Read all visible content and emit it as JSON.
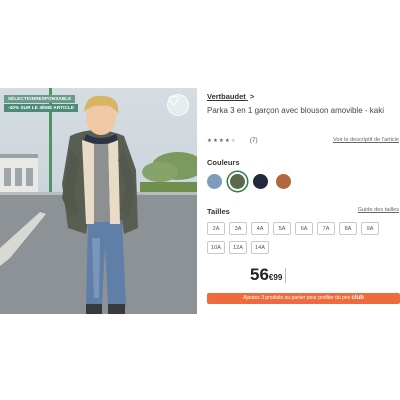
{
  "image": {
    "badge_eco": "SÉLECTIONRESPONSABLE",
    "badge_promo": "-40% SUR LE 3ÈME ARTICLE"
  },
  "product": {
    "brand": "Vertbaudet",
    "brand_arrow": ">",
    "title": "Parka 3 en 1 garçon avec blouson amovible - kaki",
    "rating_value": 4,
    "rating_count": "(7)",
    "description_link": "Voir le descriptif de l'article"
  },
  "colors": {
    "label": "Couleurs",
    "swatches": [
      {
        "name": "blue",
        "hex": "#7f9cbd",
        "selected": false
      },
      {
        "name": "khaki",
        "hex": "#5b6a4c",
        "selected": true
      },
      {
        "name": "navy",
        "hex": "#232a3c",
        "selected": false
      },
      {
        "name": "camel",
        "hex": "#b0693e",
        "selected": false
      }
    ]
  },
  "sizes": {
    "label": "Tailles",
    "guide_link": "Guide des tailles",
    "row1": [
      "2A",
      "3A",
      "4A",
      "5A",
      "6A",
      "7A",
      "8A",
      "9A"
    ],
    "row2": [
      "10A",
      "12A",
      "14A"
    ]
  },
  "price": {
    "main": "56",
    "cents": "€99"
  },
  "club_bar": {
    "text": "Ajoutez 3 produits au panier pour profiter du prix",
    "club": "club"
  },
  "theme": {
    "accent": "#ef6b3d",
    "badge_green": "#4f8a79"
  }
}
